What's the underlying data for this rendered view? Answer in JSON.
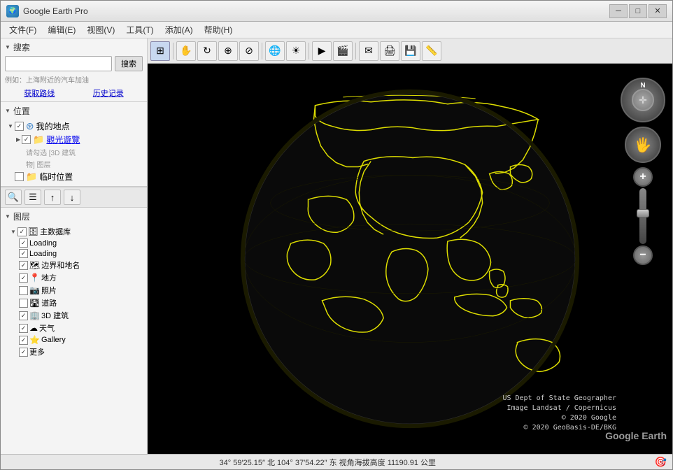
{
  "app": {
    "title": "Google Earth Pro",
    "icon": "🌍"
  },
  "titlebar": {
    "title": "Google Earth Pro",
    "minimize": "─",
    "maximize": "□",
    "close": "✕"
  },
  "menubar": {
    "items": [
      {
        "label": "文件(F)",
        "id": "file"
      },
      {
        "label": "编辑(E)",
        "id": "edit"
      },
      {
        "label": "视图(V)",
        "id": "view"
      },
      {
        "label": "工具(T)",
        "id": "tools"
      },
      {
        "label": "添加(A)",
        "id": "add"
      },
      {
        "label": "帮助(H)",
        "id": "help"
      }
    ]
  },
  "toolbar": {
    "buttons": [
      {
        "icon": "◧",
        "label": "search",
        "active": true
      },
      {
        "icon": "✋",
        "label": "pan"
      },
      {
        "icon": "⊕",
        "label": "rotate"
      },
      {
        "icon": "⊙",
        "label": "zoom-area"
      },
      {
        "icon": "🔶",
        "label": "tilt"
      },
      {
        "icon": "∿",
        "label": "grid"
      },
      {
        "icon": "☀",
        "label": "sun"
      },
      {
        "icon": "🌙",
        "label": "moon"
      },
      {
        "icon": "✉",
        "label": "email"
      },
      {
        "icon": "🖨",
        "label": "print"
      },
      {
        "icon": "💾",
        "label": "save"
      }
    ]
  },
  "search": {
    "section_label": "搜索",
    "placeholder": "",
    "button_label": "搜索",
    "hint": "例如：上海附近的汽车加油",
    "links": [
      "获取路线",
      "历史记录"
    ]
  },
  "positions": {
    "section_label": "位置",
    "items": [
      {
        "label": "我的地点",
        "checked": true,
        "type": "folder",
        "level": 0,
        "arrow": "▼"
      },
      {
        "label": "觀光遊覽",
        "checked": true,
        "type": "folder",
        "level": 1,
        "arrow": "▶",
        "blue": true
      },
      {
        "label": "请勾选 [3D 建筑物] 图层",
        "checked": false,
        "type": "text",
        "level": 2,
        "disabled": true
      },
      {
        "label": "临时位置",
        "checked": false,
        "type": "folder",
        "level": 0
      }
    ]
  },
  "layers": {
    "section_label": "图层",
    "items": [
      {
        "label": "主数据库",
        "checked": true,
        "type": "folder",
        "level": 0,
        "arrow": "▼"
      },
      {
        "label": "Loading",
        "checked": true,
        "type": "item",
        "level": 1
      },
      {
        "label": "Loading",
        "checked": true,
        "type": "item",
        "level": 1
      },
      {
        "label": "边界和地名",
        "checked": true,
        "type": "item",
        "level": 1
      },
      {
        "label": "地方",
        "checked": true,
        "type": "item",
        "level": 1
      },
      {
        "label": "照片",
        "checked": false,
        "type": "item",
        "level": 1
      },
      {
        "label": "道路",
        "checked": false,
        "type": "item",
        "level": 1
      },
      {
        "label": "3D 建筑",
        "checked": true,
        "type": "item",
        "level": 1,
        "icon": "🏢"
      },
      {
        "label": "天气",
        "checked": true,
        "type": "item",
        "level": 1,
        "icon": "☁"
      },
      {
        "label": "Gallery",
        "checked": true,
        "type": "item",
        "level": 1,
        "icon": "⭐"
      },
      {
        "label": "更多",
        "checked": true,
        "type": "item",
        "level": 1
      }
    ]
  },
  "map_controls": {
    "buttons": [
      "🔍",
      "📋",
      "→",
      "↔"
    ]
  },
  "navigation": {
    "compass_n": "N",
    "zoom_plus": "+",
    "zoom_minus": "−"
  },
  "globe_overlay": {
    "line1": "US Dept of State Geographer",
    "line2": "Image Landsat / Copernicus",
    "line3": "© 2020 Google",
    "line4": "© 2020 GeoBasis-DE/BKG"
  },
  "watermark": "Google Earth",
  "statusbar": {
    "coords": "34° 59′25.15″ 北  104° 37′54.22″ 东  视角海拔高度  11190.91 公里",
    "gps_icon": "🎯"
  }
}
